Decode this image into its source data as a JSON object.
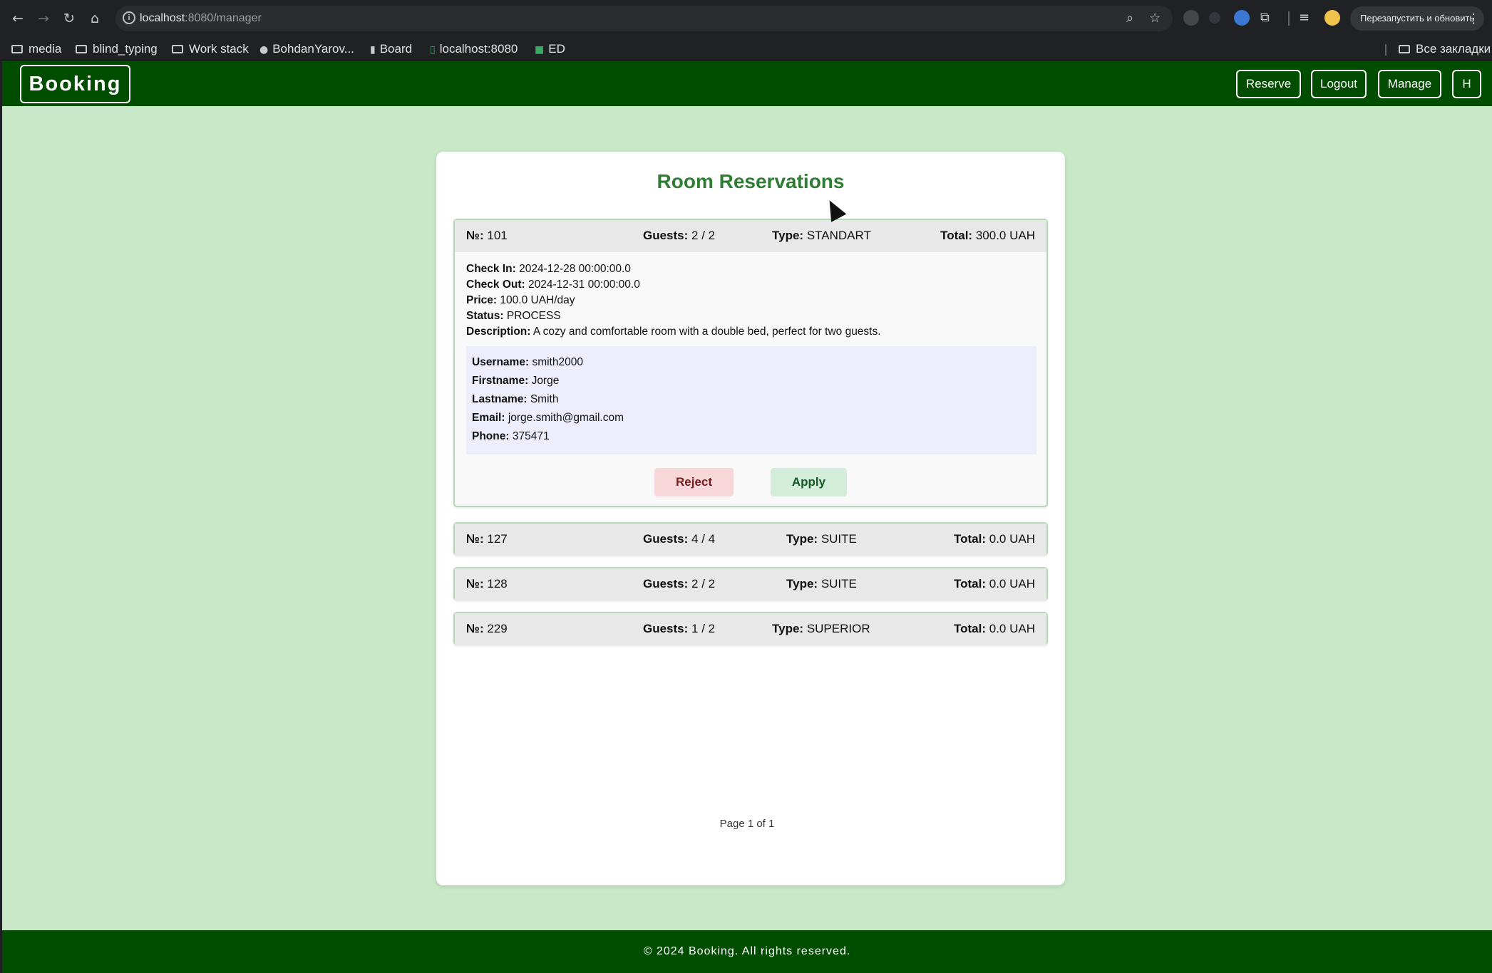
{
  "browser": {
    "url_host": "localhost",
    "url_rest": ":8080/manager",
    "relaunch_label": "Перезапустить и обновить",
    "bookmarks": [
      "media",
      "blind_typing",
      "Work stack",
      "BohdanYarov...",
      "Board",
      "localhost:8080",
      "ED"
    ],
    "all_bookmarks": "Все закладки"
  },
  "header": {
    "brand": "Booking",
    "nav": [
      "Reserve",
      "Logout",
      "Manage",
      "H"
    ]
  },
  "main": {
    "title": "Room Reservations",
    "labels": {
      "number": "№:",
      "guests": "Guests:",
      "type": "Type:",
      "total": "Total:",
      "check_in": "Check In:",
      "check_out": "Check Out:",
      "price": "Price:",
      "status": "Status:",
      "description": "Description:",
      "username": "Username:",
      "firstname": "Firstname:",
      "lastname": "Lastname:",
      "email": "Email:",
      "phone": "Phone:"
    },
    "reservations": [
      {
        "number": "101",
        "guests": "2 / 2",
        "type": "STANDART",
        "total": "300.0 UAH",
        "check_in": "2024-12-28 00:00:00.0",
        "check_out": "2024-12-31 00:00:00.0",
        "price": "100.0 UAH/day",
        "status": "PROCESS",
        "description": "A cozy and comfortable room with a double bed, perfect for two guests.",
        "user": {
          "username": "smith2000",
          "firstname": "Jorge",
          "lastname": "Smith",
          "email": "jorge.smith@gmail.com",
          "phone": "375471"
        }
      },
      {
        "number": "127",
        "guests": "4 / 4",
        "type": "SUITE",
        "total": "0.0 UAH"
      },
      {
        "number": "128",
        "guests": "2 / 2",
        "type": "SUITE",
        "total": "0.0 UAH"
      },
      {
        "number": "229",
        "guests": "1 / 2",
        "type": "SUPERIOR",
        "total": "0.0 UAH"
      }
    ],
    "actions": {
      "reject": "Reject",
      "apply": "Apply"
    },
    "pager": "Page 1 of 1"
  },
  "footer": {
    "text": "© 2024 Booking. All rights reserved."
  }
}
